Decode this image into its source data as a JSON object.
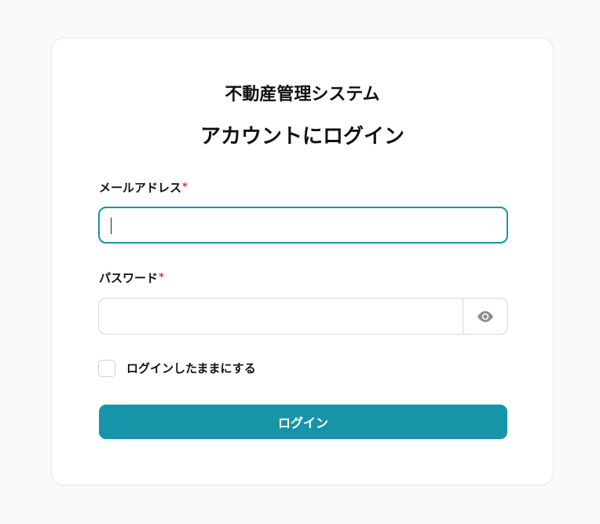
{
  "app_title": "不動産管理システム",
  "login_heading": "アカウントにログイン",
  "email": {
    "label": "メールアドレス",
    "required_mark": "*",
    "value": "",
    "placeholder": ""
  },
  "password": {
    "label": "パスワード",
    "required_mark": "*",
    "value": "",
    "placeholder": "",
    "toggle_icon": "eye-icon"
  },
  "remember_me": {
    "label": "ログインしたままにする",
    "checked": false
  },
  "login_button": {
    "label": "ログイン"
  },
  "colors": {
    "accent": "#1694a8",
    "required": "#e0383e",
    "background": "#f9f9f9",
    "card": "#ffffff"
  }
}
